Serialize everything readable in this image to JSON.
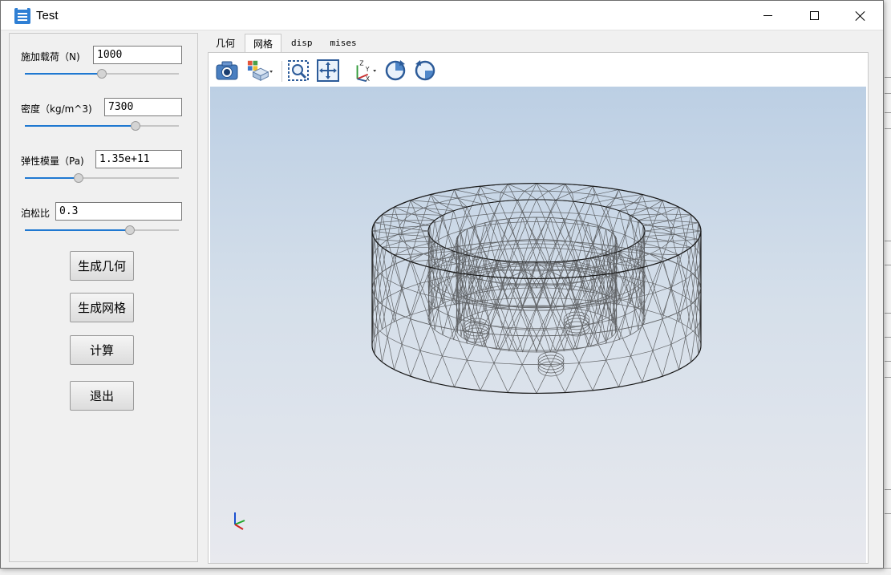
{
  "window": {
    "title": "Test"
  },
  "parameters": {
    "load": {
      "label": "施加载荷（N)",
      "value": "1000",
      "slider_fraction": 0.5
    },
    "density": {
      "label": "密度（kg/m^3)",
      "value": "7300",
      "slider_fraction": 0.72
    },
    "modulus": {
      "label": "弹性模量（Pa)",
      "value": "1.35e+11",
      "slider_fraction": 0.35
    },
    "poisson": {
      "label": "泊松比",
      "value": "0.3",
      "slider_fraction": 0.68
    }
  },
  "buttons": {
    "geometry": "生成几何",
    "mesh": "生成网格",
    "compute": "计算",
    "exit": "退出"
  },
  "tabs": [
    {
      "label": "几何",
      "active": false
    },
    {
      "label": "网格",
      "active": true
    },
    {
      "label": "disp",
      "active": false
    },
    {
      "label": "mises",
      "active": false
    }
  ],
  "toolbar": {
    "icons": [
      "camera-icon",
      "view-cube-icon",
      "zoom-box-icon",
      "fit-view-icon",
      "axes-orient-icon",
      "rotate-cw-icon",
      "rotate-ccw-icon"
    ]
  },
  "colors": {
    "accent": "#1f78d1",
    "viewport_top": "#bccfe4",
    "viewport_bottom": "#e8e9ee",
    "mesh": "#3a3a3a"
  }
}
